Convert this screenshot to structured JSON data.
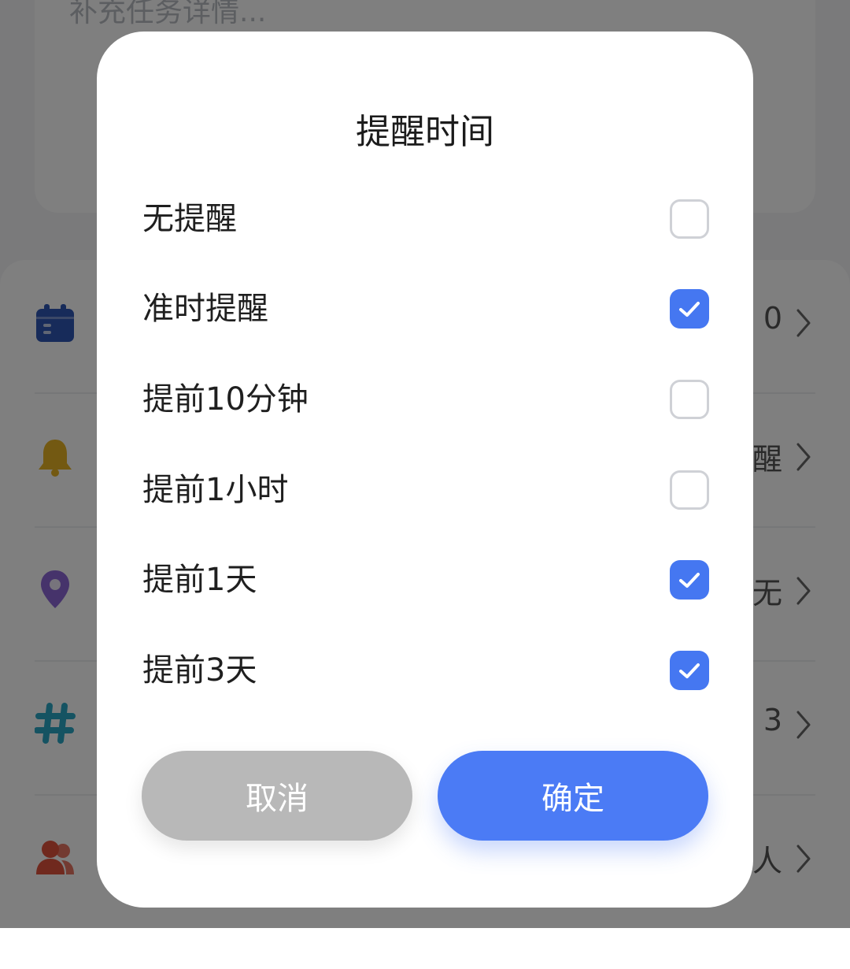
{
  "background": {
    "details_placeholder": "补充任务详情...",
    "rows": [
      {
        "icon": "calendar-icon",
        "value": "0"
      },
      {
        "icon": "bell-icon",
        "value": "醒"
      },
      {
        "icon": "location-pin-icon",
        "value": "无"
      },
      {
        "icon": "hashtag-icon",
        "value": "3"
      },
      {
        "icon": "people-icon",
        "value": "人"
      }
    ]
  },
  "dialog": {
    "title": "提醒时间",
    "options": [
      {
        "label": "无提醒",
        "checked": false
      },
      {
        "label": "准时提醒",
        "checked": true
      },
      {
        "label": "提前10分钟",
        "checked": false
      },
      {
        "label": "提前1小时",
        "checked": false
      },
      {
        "label": "提前1天",
        "checked": true
      },
      {
        "label": "提前3天",
        "checked": true
      }
    ],
    "cancel_label": "取消",
    "confirm_label": "确定"
  },
  "colors": {
    "accent": "#4b7bf5",
    "checkbox_checked": "#4577f1",
    "cancel_button": "#b8b8b8",
    "overlay": "rgba(0,0,0,0.5)"
  }
}
